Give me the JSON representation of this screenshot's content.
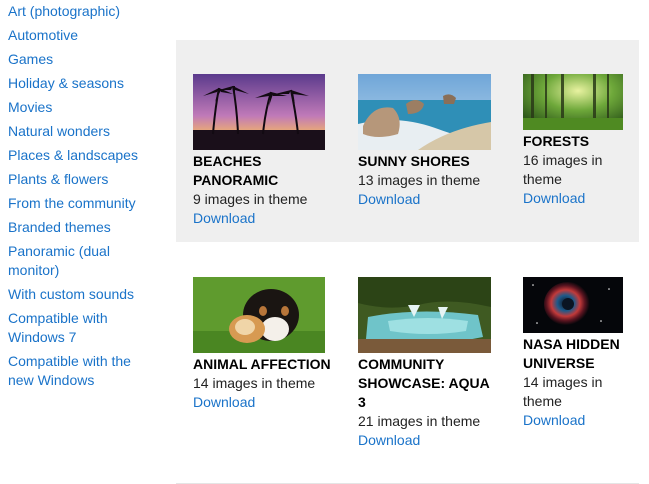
{
  "sidebar": {
    "items": [
      {
        "label": "Art (photographic)"
      },
      {
        "label": "Automotive"
      },
      {
        "label": "Games"
      },
      {
        "label": "Holiday & seasons"
      },
      {
        "label": "Movies"
      },
      {
        "label": "Natural wonders"
      },
      {
        "label": "Places & landscapes"
      },
      {
        "label": "Plants & flowers"
      },
      {
        "label": "From the community"
      },
      {
        "label": "Branded themes"
      },
      {
        "label": "Panoramic (dual monitor)"
      },
      {
        "label": "With custom sounds"
      },
      {
        "label": "Compatible with Windows 7"
      },
      {
        "label": "Compatible with the new Windows"
      }
    ]
  },
  "themes": [
    {
      "title": "BEACHES PANORAMIC",
      "count": "9 images in theme",
      "download": "Download",
      "image": "beach-palms-sunset"
    },
    {
      "title": "SUNNY SHORES",
      "count": "13 images in theme",
      "download": "Download",
      "image": "rocky-shore"
    },
    {
      "title": "FORESTS",
      "count": "16 images in theme",
      "download": "Download",
      "image": "green-forest"
    },
    {
      "title": "ANIMAL AFFECTION",
      "count": "14 images in theme",
      "download": "Download",
      "image": "puppy-and-kitten"
    },
    {
      "title": "COMMUNITY SHOWCASE: AQUA 3",
      "count": "21 images in theme",
      "download": "Download",
      "image": "waterfall-pools"
    },
    {
      "title": "NASA HIDDEN UNIVERSE",
      "count": "14 images in theme",
      "download": "Download",
      "image": "helix-nebula"
    }
  ],
  "colors": {
    "link": "#1a73c9",
    "panel": "#efefef"
  }
}
